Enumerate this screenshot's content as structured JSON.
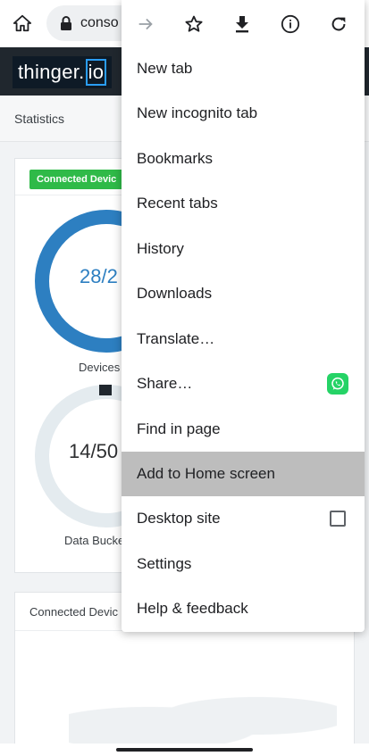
{
  "browser": {
    "url_text": "conso",
    "icons": [
      "home-icon",
      "lock-icon",
      "forward-icon",
      "star-icon",
      "download-icon",
      "info-icon",
      "refresh-icon"
    ]
  },
  "page": {
    "logo_main": "thinger.",
    "logo_suffix": "io",
    "breadcrumb": "Statistics",
    "badge": "Connected Devic",
    "gauge1_value": "28/2",
    "gauge1_label": "Devices",
    "gauge2_value": "14/50",
    "gauge2_label": "Data Bucke",
    "card2_title": "Connected Devic"
  },
  "menu": {
    "items": [
      "New tab",
      "New incognito tab",
      "Bookmarks",
      "Recent tabs",
      "History",
      "Downloads",
      "Translate…",
      "Share…",
      "Find in page",
      "Add to Home screen",
      "Desktop site",
      "Settings",
      "Help & feedback"
    ],
    "highlighted": "Add to Home screen"
  },
  "colors": {
    "accent_blue": "#2d7fc1",
    "badge_green": "#2fba48",
    "whatsapp_green": "#25d366",
    "header_dark": "#20272e"
  }
}
